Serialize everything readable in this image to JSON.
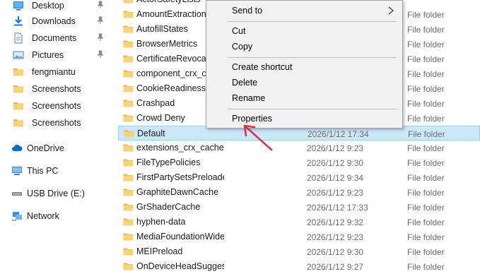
{
  "nav": {
    "items": [
      {
        "label": "Desktop",
        "icon": "desktop-icon",
        "pinned": true
      },
      {
        "label": "Downloads",
        "icon": "download-icon",
        "pinned": true
      },
      {
        "label": "Documents",
        "icon": "document-icon",
        "pinned": true
      },
      {
        "label": "Pictures",
        "icon": "pictures-icon",
        "pinned": true
      },
      {
        "label": "fengmiantu",
        "icon": "folder-icon",
        "pinned": false
      },
      {
        "label": "Screenshots",
        "icon": "folder-icon",
        "pinned": false
      },
      {
        "label": "Screenshots",
        "icon": "folder-icon",
        "pinned": false
      },
      {
        "label": "Screenshots",
        "icon": "folder-icon",
        "pinned": false
      }
    ],
    "roots": [
      {
        "label": "OneDrive",
        "icon": "cloud-icon"
      },
      {
        "label": "This PC",
        "icon": "monitor-icon"
      },
      {
        "label": "USB Drive (E:)",
        "icon": "usb-drive-icon"
      },
      {
        "label": "Network",
        "icon": "network-icon"
      }
    ]
  },
  "files": [
    {
      "name": "ActorSafetyLists",
      "date": "",
      "type": ""
    },
    {
      "name": "AmountExtractionHeuristicRegexes",
      "date": "",
      "type": "File folder"
    },
    {
      "name": "AutofillStates",
      "date": "",
      "type": "File folder"
    },
    {
      "name": "BrowserMetrics",
      "date": "",
      "type": "File folder"
    },
    {
      "name": "CertificateRevocation",
      "date": "",
      "type": "File folder"
    },
    {
      "name": "component_crx_cache",
      "date": "",
      "type": "File folder"
    },
    {
      "name": "CookieReadinessList",
      "date": "",
      "type": "File folder"
    },
    {
      "name": "Crashpad",
      "date": "",
      "type": "File folder"
    },
    {
      "name": "Crowd Deny",
      "date": "",
      "type": "File folder"
    },
    {
      "name": "Default",
      "date": "2026/1/12 17:34",
      "type": "File folder",
      "selected": true
    },
    {
      "name": "extensions_crx_cache",
      "date": "2026/1/12 9:23",
      "type": "File folder"
    },
    {
      "name": "FileTypePolicies",
      "date": "2026/1/12 9:30",
      "type": "File folder"
    },
    {
      "name": "FirstPartySetsPreloaded",
      "date": "2026/1/12 9:34",
      "type": "File folder"
    },
    {
      "name": "GraphiteDawnCache",
      "date": "2026/1/12 9:23",
      "type": "File folder"
    },
    {
      "name": "GrShaderCache",
      "date": "2026/1/12 17:33",
      "type": "File folder"
    },
    {
      "name": "hyphen-data",
      "date": "2026/1/12 9:32",
      "type": "File folder"
    },
    {
      "name": "MediaFoundationWidevineCdm",
      "date": "2026/1/12 9:23",
      "type": "File folder"
    },
    {
      "name": "MEIPreload",
      "date": "2026/1/12 9:30",
      "type": "File folder"
    },
    {
      "name": "OnDeviceHeadSuggestModel",
      "date": "2026/1/12 9:27",
      "type": "File folder"
    }
  ],
  "context_menu": {
    "send_to": "Send to",
    "cut": "Cut",
    "copy": "Copy",
    "create_shortcut": "Create shortcut",
    "delete": "Delete",
    "rename": "Rename",
    "properties": "Properties"
  },
  "colors": {
    "selection": "#cce8ff",
    "folder": "#f2c55c",
    "arrow": "#d9334a"
  }
}
